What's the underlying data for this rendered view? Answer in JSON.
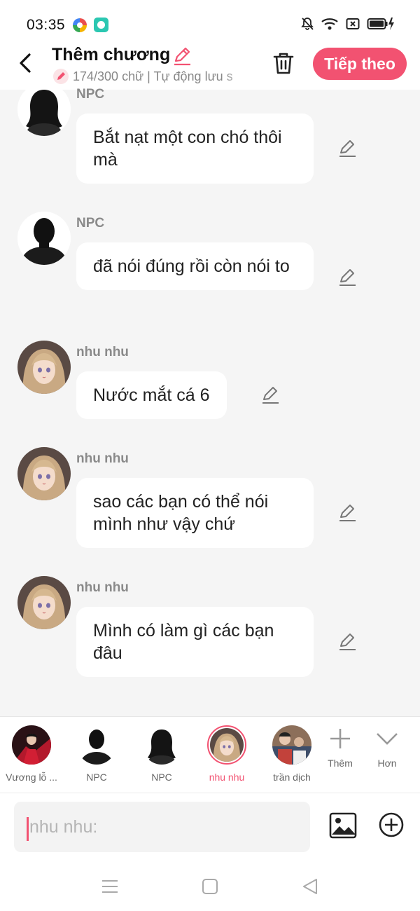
{
  "status_bar": {
    "time": "03:35"
  },
  "header": {
    "title": "Thêm chương",
    "meta": "174/300 chữ | Tự động lưu s",
    "next_label": "Tiếp theo"
  },
  "messages": [
    {
      "sender": "NPC",
      "text": "Bắt nạt một con chó thôi mà",
      "avatar": "female-silhouette"
    },
    {
      "sender": "NPC",
      "text": "đã nói đúng rồi còn nói to",
      "avatar": "male-silhouette"
    },
    {
      "sender": "nhu nhu",
      "text": "Nước mắt cá 6",
      "avatar": "anime-girl"
    },
    {
      "sender": "nhu nhu",
      "text": "sao các bạn có thể nói mình như vậy chứ",
      "avatar": "anime-girl"
    },
    {
      "sender": "nhu nhu",
      "text": "Mình có làm gì các bạn đâu",
      "avatar": "anime-girl"
    }
  ],
  "characters": [
    {
      "name": "Vương lỗ ...",
      "avatar": "red-dress-person"
    },
    {
      "name": "NPC",
      "avatar": "male-silhouette"
    },
    {
      "name": "NPC",
      "avatar": "female-silhouette"
    },
    {
      "name": "nhu nhu",
      "avatar": "anime-girl",
      "selected": true
    },
    {
      "name": "trần dịch",
      "avatar": "group-photo"
    }
  ],
  "char_actions": {
    "add_label": "Thêm",
    "more_label": "Hơn"
  },
  "input": {
    "placeholder": "nhu nhu:"
  },
  "colors": {
    "accent": "#f25271",
    "background": "#f5f5f5",
    "bubble": "#ffffff"
  }
}
